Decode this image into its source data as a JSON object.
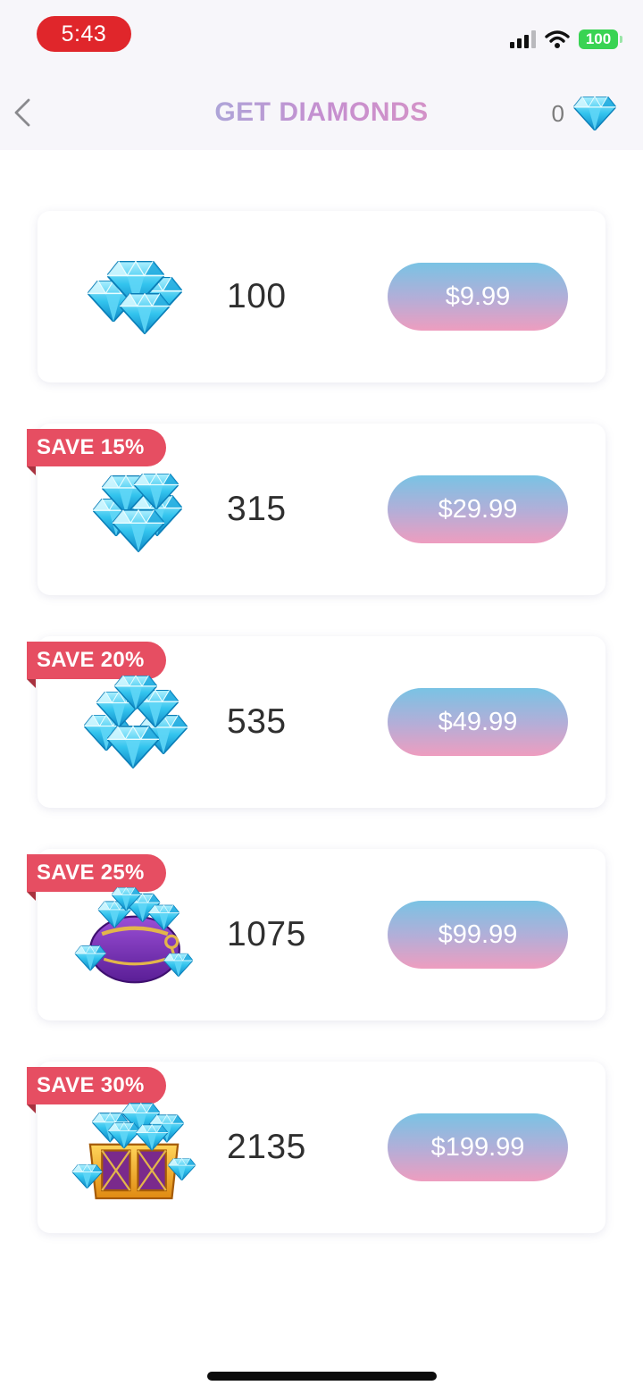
{
  "status_bar": {
    "time": "5:43",
    "battery": "100"
  },
  "header": {
    "title": "GET DIAMONDS",
    "balance": "0",
    "back_icon": "chevron-left-icon",
    "balance_icon": "diamond-icon"
  },
  "packs": [
    {
      "amount": "100",
      "price": "$9.99",
      "save": "",
      "icon": "diamond-pile-small-icon"
    },
    {
      "amount": "315",
      "price": "$29.99",
      "save": "SAVE 15%",
      "icon": "diamond-pile-medium-icon"
    },
    {
      "amount": "535",
      "price": "$49.99",
      "save": "SAVE 20%",
      "icon": "diamond-pile-large-icon"
    },
    {
      "amount": "1075",
      "price": "$99.99",
      "save": "SAVE 25%",
      "icon": "diamond-bag-icon"
    },
    {
      "amount": "2135",
      "price": "$199.99",
      "save": "SAVE 30%",
      "icon": "diamond-chest-icon"
    }
  ],
  "colors": {
    "badge": "#e64e62",
    "title_gradient_start": "#7fd1e8",
    "title_gradient_end": "#f199b6",
    "button_top": "#79c3e4",
    "button_bottom": "#ee9dbf",
    "diamond": "#37c6ee"
  }
}
